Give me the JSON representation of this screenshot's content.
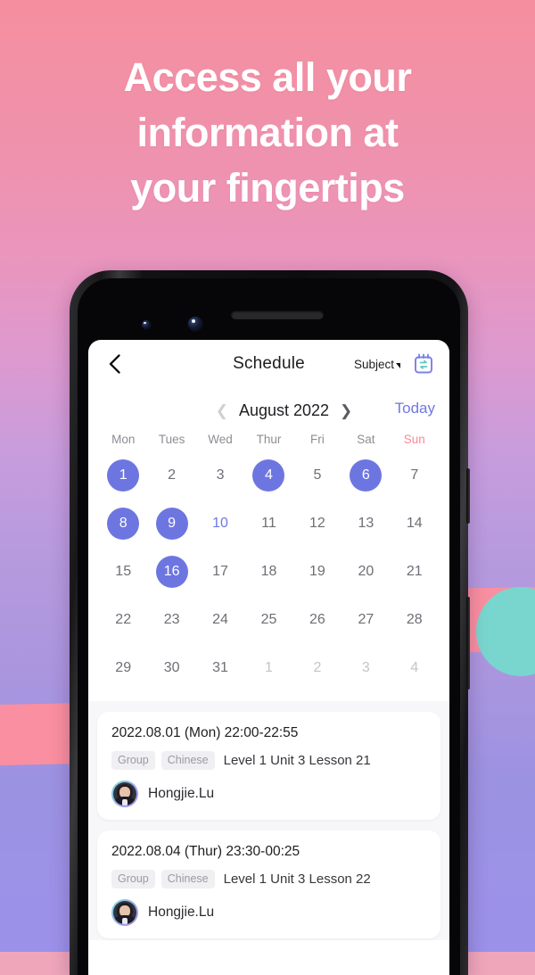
{
  "promo": {
    "headline_lines": [
      "Access all your",
      "information at",
      "your fingertips"
    ],
    "background_top_color": "#f58f9f",
    "background_bottom_color": "#9b91ea",
    "accent_pink": "#f98fa0",
    "accent_teal": "#79d6ce"
  },
  "app": {
    "accent_color": "#6d76e0",
    "navbar": {
      "back_icon": "chevron-left-icon",
      "title": "Schedule",
      "subject_filter_label": "Subject",
      "subject_caret_icon": "caret-down-icon",
      "calendar_sync_icon": "calendar-sync-icon"
    },
    "calendar": {
      "prev_icon": "chevron-left-icon",
      "next_icon": "chevron-right-icon",
      "month_label": "August 2022",
      "today_label": "Today",
      "weekdays": [
        "Mon",
        "Tues",
        "Wed",
        "Thur",
        "Fri",
        "Sat",
        "Sun"
      ],
      "sunday_color": "#fb8796",
      "weeks": [
        [
          {
            "d": "1",
            "state": "marked"
          },
          {
            "d": "2",
            "state": "normal"
          },
          {
            "d": "3",
            "state": "normal"
          },
          {
            "d": "4",
            "state": "marked"
          },
          {
            "d": "5",
            "state": "normal"
          },
          {
            "d": "6",
            "state": "marked"
          },
          {
            "d": "7",
            "state": "normal"
          }
        ],
        [
          {
            "d": "8",
            "state": "marked"
          },
          {
            "d": "9",
            "state": "marked"
          },
          {
            "d": "10",
            "state": "today"
          },
          {
            "d": "11",
            "state": "normal"
          },
          {
            "d": "12",
            "state": "normal"
          },
          {
            "d": "13",
            "state": "normal"
          },
          {
            "d": "14",
            "state": "normal"
          }
        ],
        [
          {
            "d": "15",
            "state": "normal"
          },
          {
            "d": "16",
            "state": "marked"
          },
          {
            "d": "17",
            "state": "normal"
          },
          {
            "d": "18",
            "state": "normal"
          },
          {
            "d": "19",
            "state": "normal"
          },
          {
            "d": "20",
            "state": "normal"
          },
          {
            "d": "21",
            "state": "normal"
          }
        ],
        [
          {
            "d": "22",
            "state": "normal"
          },
          {
            "d": "23",
            "state": "normal"
          },
          {
            "d": "24",
            "state": "normal"
          },
          {
            "d": "25",
            "state": "normal"
          },
          {
            "d": "26",
            "state": "normal"
          },
          {
            "d": "27",
            "state": "normal"
          },
          {
            "d": "28",
            "state": "normal"
          }
        ],
        [
          {
            "d": "29",
            "state": "normal"
          },
          {
            "d": "30",
            "state": "normal"
          },
          {
            "d": "31",
            "state": "normal"
          },
          {
            "d": "1",
            "state": "muted"
          },
          {
            "d": "2",
            "state": "muted"
          },
          {
            "d": "3",
            "state": "muted"
          },
          {
            "d": "4",
            "state": "muted"
          }
        ]
      ]
    },
    "events": [
      {
        "time": "2022.08.01 (Mon) 22:00-22:55",
        "tags": [
          "Group",
          "Chinese"
        ],
        "lesson": "Level 1 Unit 3 Lesson 21",
        "teacher": "Hongjie.Lu",
        "avatar_icon": "teacher-avatar"
      },
      {
        "time": "2022.08.04 (Thur) 23:30-00:25",
        "tags": [
          "Group",
          "Chinese"
        ],
        "lesson": "Level 1 Unit 3 Lesson 22",
        "teacher": "Hongjie.Lu",
        "avatar_icon": "teacher-avatar"
      }
    ]
  }
}
